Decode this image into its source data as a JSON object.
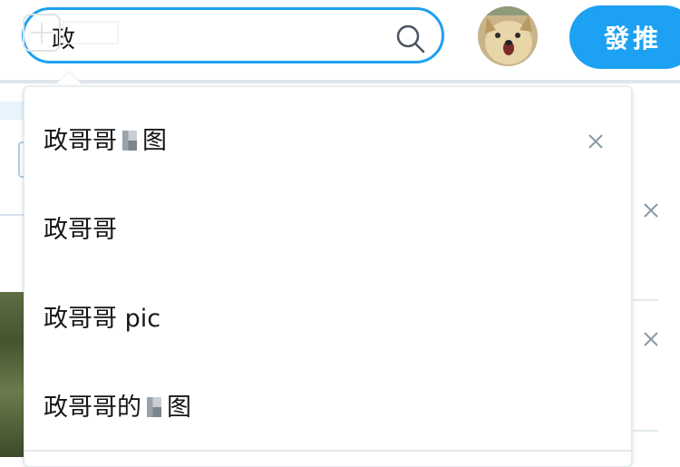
{
  "header": {
    "search": {
      "value": "政",
      "placeholder": "",
      "icon": "search-icon"
    },
    "avatar": "avatar-doge",
    "tweet_button_label": "發推"
  },
  "dropdown": {
    "items": [
      {
        "label_pre": "政哥哥",
        "label_post": "图",
        "obscured": true,
        "removable": true
      },
      {
        "label_pre": "政哥哥",
        "label_post": "",
        "obscured": false,
        "removable": false
      },
      {
        "label_pre": "政哥哥 pic",
        "label_post": "",
        "obscured": false,
        "removable": false
      },
      {
        "label_pre": "政哥哥的",
        "label_post": "图",
        "obscured": true,
        "removable": false
      }
    ]
  },
  "colors": {
    "accent": "#1da1f2",
    "text": "#14171a",
    "muted": "#8899a6",
    "border": "#e1e8ed"
  }
}
